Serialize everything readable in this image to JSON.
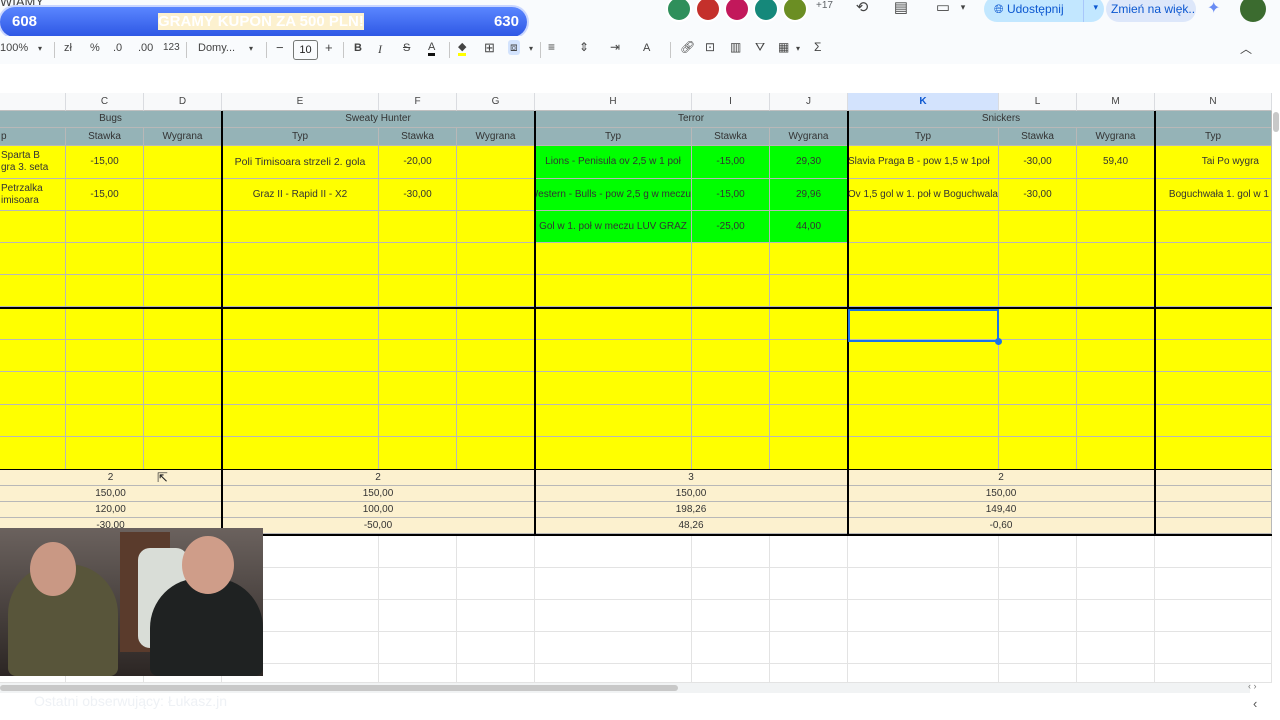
{
  "doc": {
    "title": "WIAMY"
  },
  "banner": {
    "left": "608",
    "text": "GRAMY KUPON ZA 500 PLN!",
    "right": "630"
  },
  "header": {
    "avatar_colors": [
      "#2f8f5b",
      "#c4302b",
      "#c2185b",
      "#15887a",
      "#6b8e23"
    ],
    "more_count": "+17",
    "share_label": "Udostępnij",
    "resize_label": "Zmień na więk..."
  },
  "toolbar": {
    "zoom": "100%",
    "currency": "zł",
    "percent": "%",
    "dec_dec": ".0",
    "dec_inc": ".00",
    "format_123": "123",
    "font": "Domy...",
    "font_size": "10",
    "minus": "−",
    "plus": "+",
    "bold": "B",
    "italic": "I",
    "strike": "S",
    "text_color": "A",
    "sigma": "Σ"
  },
  "columns": [
    "C",
    "D",
    "E",
    "F",
    "G",
    "H",
    "I",
    "J",
    "K",
    "L",
    "M",
    "N"
  ],
  "groups": [
    "Bugs",
    "Sweaty Hunter",
    "Terror",
    "Snickers"
  ],
  "subheaders": {
    "typ": "Typ",
    "stawka": "Stawka",
    "wygrana": "Wygrana",
    "partial": "p"
  },
  "rows": {
    "b_row1": "Sparta B",
    "b_row1b": "gra 3. seta",
    "b_row2": "Petrzalka",
    "b_row2b": "imisoara",
    "c_row1": "-15,00",
    "c_row2": "-15,00",
    "e_row1": "Poli Timisoara strzeli 2. gola",
    "e_row2": "Graz II - Rapid II - X2",
    "f_row1": "-20,00",
    "f_row2": "-30,00",
    "h_row1": "Lions - Penisula ov 2,5 w 1 poł",
    "h_row2": "Western - Bulls - pow 2,5 g w meczu",
    "h_row3": "Gol w 1. poł w meczu LUV GRAZ",
    "i_row1": "-15,00",
    "i_row2": "-15,00",
    "i_row3": "-25,00",
    "j_row1": "29,30",
    "j_row2": "29,96",
    "j_row3": "44,00",
    "k_row1": "Slavia Praga B - pow 1,5 w 1poł",
    "k_row2": "Ov 1,5 gol w 1. poł w Boguchwala",
    "l_row1": "-30,00",
    "l_row2": "-30,00",
    "m_row1": "59,40",
    "n_row1": "Tai Po wygra",
    "n_row2": "Boguchwała 1. gol w 1"
  },
  "summary": {
    "bugs": [
      "2",
      "150,00",
      "120,00",
      "-30,00"
    ],
    "sweaty": [
      "2",
      "150,00",
      "100,00",
      "-50,00"
    ],
    "terror": [
      "3",
      "150,00",
      "198,26",
      "48,26"
    ],
    "snickers": [
      "2",
      "150,00",
      "149,40",
      "-0,60"
    ]
  },
  "status": {
    "text": "Ostatni obserwujący: Łukasz.jn"
  }
}
